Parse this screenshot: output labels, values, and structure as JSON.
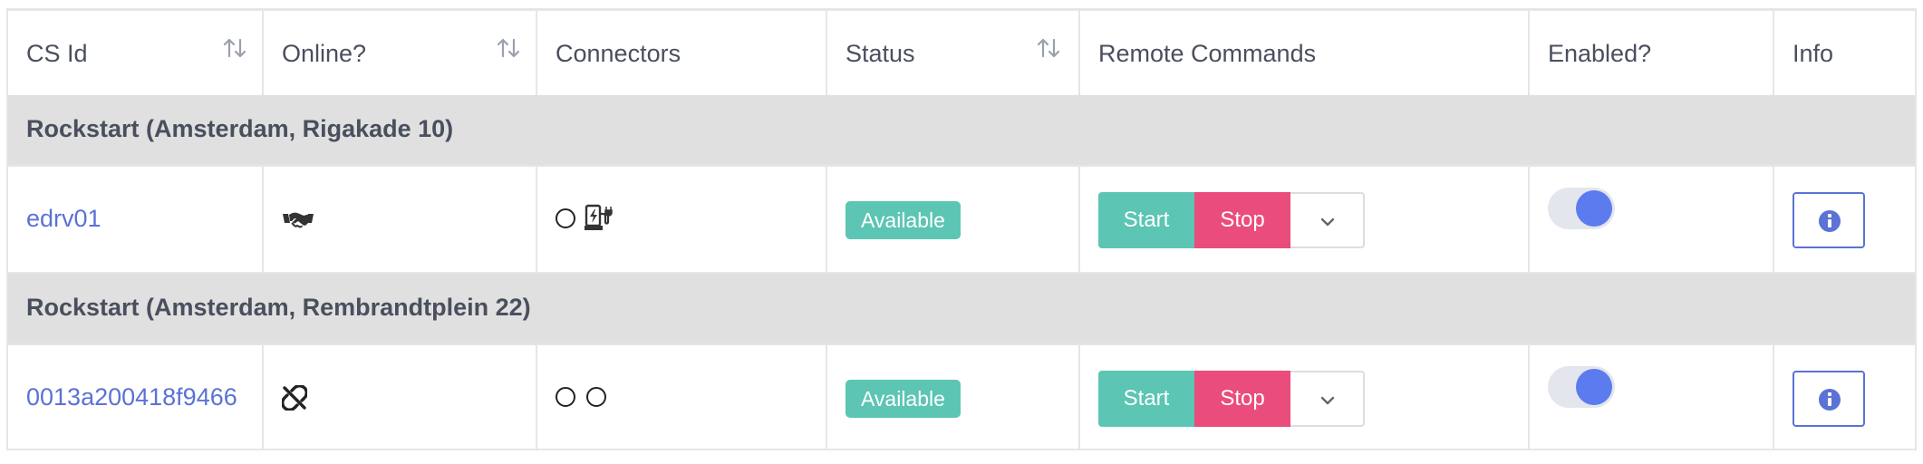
{
  "columns": [
    {
      "label": "CS Id",
      "sortable": true
    },
    {
      "label": "Online?",
      "sortable": true
    },
    {
      "label": "Connectors",
      "sortable": false
    },
    {
      "label": "Status",
      "sortable": true
    },
    {
      "label": "Remote Commands",
      "sortable": false
    },
    {
      "label": "Enabled?",
      "sortable": false
    },
    {
      "label": "Info",
      "sortable": false
    }
  ],
  "groups": [
    {
      "label": "Rockstart (Amsterdam, Rigakade 10)",
      "station": {
        "cs_id": "edrv01",
        "online_icon": "handshake-icon",
        "connector_icons": [
          "connector-empty-circle-icon",
          "ev-charger-icon"
        ],
        "status": "Available",
        "start_label": "Start",
        "stop_label": "Stop",
        "more_icon": "chevron-down-icon",
        "enabled": true,
        "info_icon": "info-circle-icon"
      }
    },
    {
      "label": "Rockstart (Amsterdam, Rembrandtplein 22)",
      "station": {
        "cs_id": "0013a200418f9466",
        "online_icon": "unlink-icon",
        "connector_icons": [
          "connector-empty-circle-icon",
          "connector-empty-circle-icon"
        ],
        "status": "Available",
        "start_label": "Start",
        "stop_label": "Stop",
        "more_icon": "chevron-down-icon",
        "enabled": true,
        "info_icon": "info-circle-icon"
      }
    }
  ],
  "colors": {
    "status_available": "#5cc5b3",
    "start_button": "#5cc5b3",
    "stop_button": "#ea4d7b",
    "link": "#5b72d6",
    "toggle_on": "#5b7bef",
    "group_background": "#e0e0e0"
  }
}
